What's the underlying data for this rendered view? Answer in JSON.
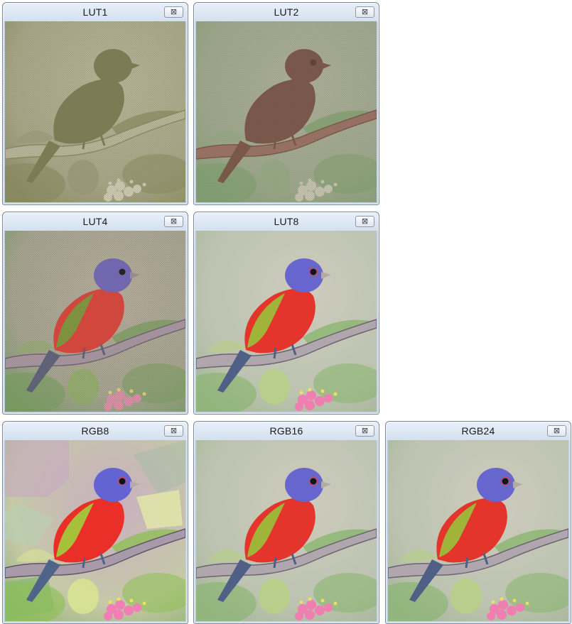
{
  "windows": [
    {
      "title": "LUT1",
      "close_glyph": "⊠",
      "palette": "lut1"
    },
    {
      "title": "LUT2",
      "close_glyph": "⊠",
      "palette": "lut2"
    },
    {
      "title": "LUT4",
      "close_glyph": "⊠",
      "palette": "lut4"
    },
    {
      "title": "LUT8",
      "close_glyph": "⊠",
      "palette": "full"
    },
    {
      "title": "RGB8",
      "close_glyph": "⊠",
      "palette": "rgb8"
    },
    {
      "title": "RGB16",
      "close_glyph": "⊠",
      "palette": "full"
    },
    {
      "title": "RGB24",
      "close_glyph": "⊠",
      "palette": "full"
    }
  ],
  "image_subject": "painted-bunting-on-branch",
  "colors": {
    "title_bar_top": "#e9f1fa",
    "title_bar_bottom": "#c6d5e5",
    "window_border": "#7a8696"
  }
}
